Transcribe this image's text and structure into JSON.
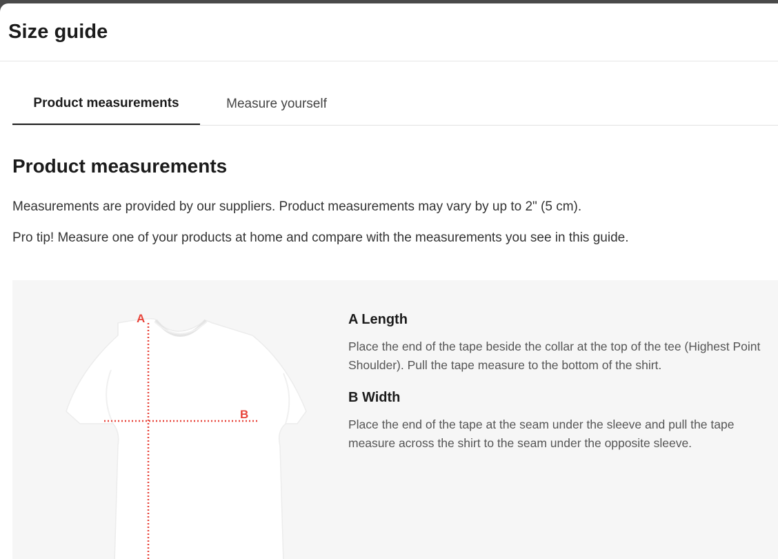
{
  "dialog": {
    "title": "Size guide"
  },
  "tabs": [
    {
      "label": "Product measurements",
      "active": true
    },
    {
      "label": "Measure yourself",
      "active": false
    }
  ],
  "section": {
    "heading": "Product measurements",
    "paragraph1": "Measurements are provided by our suppliers. Product measurements may vary by up to 2\" (5 cm).",
    "paragraph2": "Pro tip! Measure one of your products at home and compare with the measurements you see in this guide."
  },
  "diagram": {
    "marker_a": "A",
    "marker_b": "B",
    "guide_color": "#e8443a"
  },
  "measurements": [
    {
      "title": "A Length",
      "description": "Place the end of the tape beside the collar at the top of the tee (Highest Point Shoulder). Pull the tape measure to the bottom of the shirt."
    },
    {
      "title": "B Width",
      "description": "Place the end of the tape at the seam under the sleeve and pull the tape measure across the shirt to the seam under the opposite sleeve."
    }
  ]
}
